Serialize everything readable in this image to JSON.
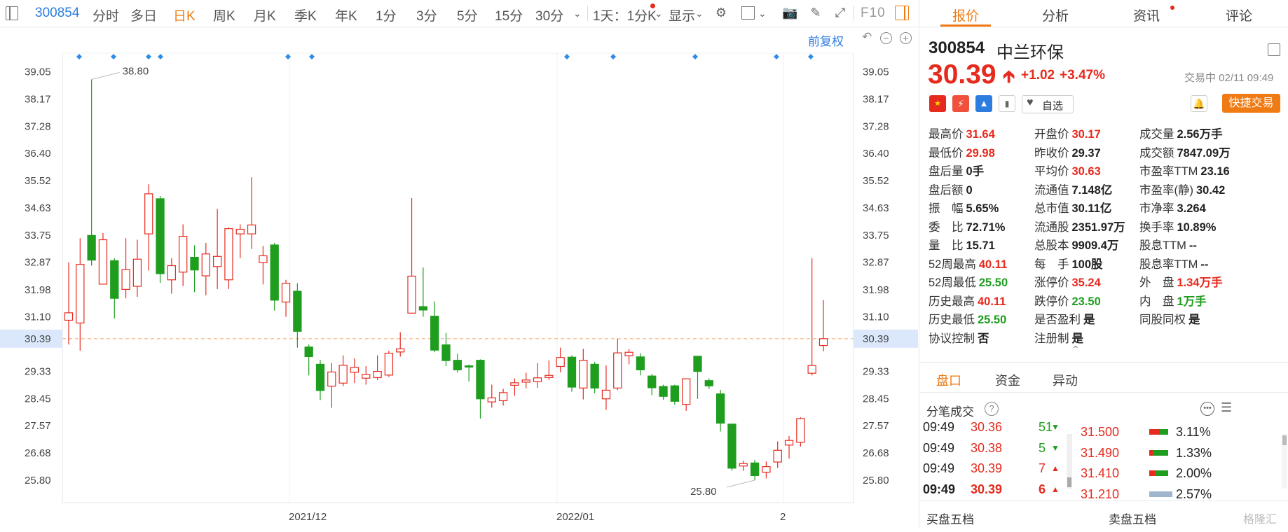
{
  "toolbar": {
    "code": "300854",
    "tabs": [
      "分时",
      "多日",
      "日K",
      "周K",
      "月K",
      "季K",
      "年K",
      "1分",
      "3分",
      "5分",
      "15分",
      "30分"
    ],
    "active_tab": "日K",
    "range_label": "1天：1分K",
    "display_label": "显示",
    "f10_label": "F10"
  },
  "chart": {
    "adjust_label": "前复权",
    "y_ticks": [
      "39.05",
      "38.17",
      "37.28",
      "36.40",
      "35.52",
      "34.63",
      "33.75",
      "32.87",
      "31.98",
      "31.10",
      "30.39",
      "29.33",
      "28.45",
      "27.57",
      "26.68",
      "25.80"
    ],
    "current_price_label": "30.39",
    "high_label": "38.80",
    "low_label": "25.80",
    "x_labels": [
      "2021/12",
      "2022/01",
      "2"
    ],
    "up_color": "#e62a1e",
    "down_color": "#1f9d1f",
    "candles": [
      {
        "o": 30.99,
        "c": 31.23,
        "h": 32.87,
        "l": 30.2
      },
      {
        "o": 30.9,
        "c": 32.8,
        "h": 33.65,
        "l": 30.0
      },
      {
        "o": 33.74,
        "c": 32.94,
        "h": 38.8,
        "l": 32.76
      },
      {
        "o": 32.16,
        "c": 33.6,
        "h": 33.82,
        "l": 32.15
      },
      {
        "o": 32.92,
        "c": 31.7,
        "h": 33.0,
        "l": 31.05
      },
      {
        "o": 31.99,
        "c": 32.63,
        "h": 33.65,
        "l": 31.7
      },
      {
        "o": 32.09,
        "c": 32.97,
        "h": 33.6,
        "l": 31.75
      },
      {
        "o": 33.79,
        "c": 35.09,
        "h": 35.4,
        "l": 32.6
      },
      {
        "o": 34.93,
        "c": 32.5,
        "h": 35.02,
        "l": 32.2
      },
      {
        "o": 32.3,
        "c": 32.76,
        "h": 33.0,
        "l": 31.85
      },
      {
        "o": 32.55,
        "c": 33.71,
        "h": 34.1,
        "l": 32.1
      },
      {
        "o": 33.03,
        "c": 32.62,
        "h": 33.42,
        "l": 31.9
      },
      {
        "o": 32.43,
        "c": 33.14,
        "h": 33.5,
        "l": 31.8
      },
      {
        "o": 32.73,
        "c": 33.06,
        "h": 34.6,
        "l": 32.0
      },
      {
        "o": 32.3,
        "c": 33.96,
        "h": 34.0,
        "l": 32.0
      },
      {
        "o": 33.79,
        "c": 33.94,
        "h": 34.1,
        "l": 33.0
      },
      {
        "o": 33.79,
        "c": 34.08,
        "h": 35.63,
        "l": 33.3
      },
      {
        "o": 32.86,
        "c": 33.08,
        "h": 33.4,
        "l": 32.15
      },
      {
        "o": 33.43,
        "c": 31.64,
        "h": 33.5,
        "l": 31.3
      },
      {
        "o": 31.58,
        "c": 32.19,
        "h": 32.3,
        "l": 31.1
      },
      {
        "o": 31.93,
        "c": 30.63,
        "h": 32.19,
        "l": 30.1
      },
      {
        "o": 30.12,
        "c": 29.81,
        "h": 30.2,
        "l": 29.2
      },
      {
        "o": 29.56,
        "c": 28.71,
        "h": 29.7,
        "l": 28.4
      },
      {
        "o": 28.85,
        "c": 29.31,
        "h": 29.6,
        "l": 28.15
      },
      {
        "o": 28.95,
        "c": 29.53,
        "h": 29.85,
        "l": 28.85
      },
      {
        "o": 29.3,
        "c": 29.46,
        "h": 29.75,
        "l": 28.95
      },
      {
        "o": 29.11,
        "c": 29.23,
        "h": 29.5,
        "l": 28.9
      },
      {
        "o": 29.13,
        "c": 29.33,
        "h": 29.85,
        "l": 29.05
      },
      {
        "o": 29.21,
        "c": 29.92,
        "h": 30.0,
        "l": 29.15
      },
      {
        "o": 29.96,
        "c": 30.06,
        "h": 30.6,
        "l": 29.81
      },
      {
        "o": 31.22,
        "c": 32.42,
        "h": 34.95,
        "l": 31.2
      },
      {
        "o": 31.43,
        "c": 31.32,
        "h": 32.7,
        "l": 31.1
      },
      {
        "o": 31.12,
        "c": 30.02,
        "h": 31.6,
        "l": 29.95
      },
      {
        "o": 30.19,
        "c": 29.68,
        "h": 30.58,
        "l": 29.5
      },
      {
        "o": 29.69,
        "c": 29.38,
        "h": 29.9,
        "l": 29.29
      },
      {
        "o": 29.51,
        "c": 29.47,
        "h": 29.55,
        "l": 29.0
      },
      {
        "o": 29.69,
        "c": 28.44,
        "h": 29.72,
        "l": 27.8
      },
      {
        "o": 28.34,
        "c": 28.47,
        "h": 28.9,
        "l": 28.15
      },
      {
        "o": 28.38,
        "c": 28.64,
        "h": 28.76,
        "l": 28.22
      },
      {
        "o": 28.88,
        "c": 28.96,
        "h": 29.1,
        "l": 28.54
      },
      {
        "o": 28.98,
        "c": 29.05,
        "h": 29.29,
        "l": 28.78
      },
      {
        "o": 29.0,
        "c": 29.12,
        "h": 29.6,
        "l": 28.8
      },
      {
        "o": 29.13,
        "c": 29.2,
        "h": 29.69,
        "l": 29.05
      },
      {
        "o": 29.49,
        "c": 29.78,
        "h": 30.1,
        "l": 29.3
      },
      {
        "o": 29.79,
        "c": 28.82,
        "h": 29.85,
        "l": 28.67
      },
      {
        "o": 28.79,
        "c": 29.69,
        "h": 30.06,
        "l": 28.42
      },
      {
        "o": 29.56,
        "c": 28.79,
        "h": 29.64,
        "l": 28.62
      },
      {
        "o": 28.44,
        "c": 28.72,
        "h": 29.52,
        "l": 28.08
      },
      {
        "o": 28.79,
        "c": 29.93,
        "h": 30.39,
        "l": 28.72
      },
      {
        "o": 29.84,
        "c": 29.95,
        "h": 30.05,
        "l": 29.56
      },
      {
        "o": 29.8,
        "c": 29.38,
        "h": 29.92,
        "l": 29.2
      },
      {
        "o": 29.18,
        "c": 28.8,
        "h": 29.25,
        "l": 28.55
      },
      {
        "o": 28.84,
        "c": 28.52,
        "h": 28.9,
        "l": 28.41
      },
      {
        "o": 28.86,
        "c": 28.36,
        "h": 28.9,
        "l": 28.25
      },
      {
        "o": 28.26,
        "c": 29.09,
        "h": 29.09,
        "l": 28.05
      },
      {
        "o": 29.82,
        "c": 29.33,
        "h": 29.83,
        "l": 28.44
      },
      {
        "o": 29.03,
        "c": 28.86,
        "h": 29.1,
        "l": 28.76
      },
      {
        "o": 28.6,
        "c": 27.65,
        "h": 28.73,
        "l": 27.38
      },
      {
        "o": 27.62,
        "c": 26.19,
        "h": 27.62,
        "l": 26.11
      },
      {
        "o": 26.26,
        "c": 26.34,
        "h": 26.43,
        "l": 26.1
      },
      {
        "o": 26.36,
        "c": 25.95,
        "h": 26.46,
        "l": 25.8
      },
      {
        "o": 26.06,
        "c": 26.24,
        "h": 26.41,
        "l": 25.86
      },
      {
        "o": 26.39,
        "c": 26.77,
        "h": 27.06,
        "l": 26.2
      },
      {
        "o": 26.94,
        "c": 27.09,
        "h": 27.23,
        "l": 26.5
      },
      {
        "o": 27.03,
        "c": 27.8,
        "h": 27.84,
        "l": 26.89
      },
      {
        "o": 29.27,
        "c": 29.52,
        "h": 33.0,
        "l": 29.2
      },
      {
        "o": 30.17,
        "c": 30.39,
        "h": 31.64,
        "l": 29.98
      }
    ]
  },
  "quote": {
    "code": "300854",
    "name": "中兰环保",
    "price": "30.39",
    "change": "+1.02",
    "change_pct": "+3.47%",
    "status": "交易中 02/11 09:49",
    "watch_label": "自选",
    "trade_label": "快捷交易"
  },
  "panel_tabs": [
    "报价",
    "分析",
    "资讯",
    "评论"
  ],
  "stats": [
    [
      {
        "k": "最高价",
        "v": "31.64",
        "c": "red"
      },
      {
        "k": "开盘价",
        "v": "30.17",
        "c": "red"
      },
      {
        "k": "成交量",
        "v": "2.56万手",
        "c": "dark"
      }
    ],
    [
      {
        "k": "最低价",
        "v": "29.98",
        "c": "red"
      },
      {
        "k": "昨收价",
        "v": "29.37",
        "c": "dark"
      },
      {
        "k": "成交额",
        "v": "7847.09万",
        "c": "dark"
      }
    ],
    [
      {
        "k": "盘后量",
        "v": "0手",
        "c": "dark"
      },
      {
        "k": "平均价",
        "v": "30.63",
        "c": "red"
      },
      {
        "k": "市盈率TTM",
        "v": "23.16",
        "c": "dark"
      }
    ],
    [
      {
        "k": "盘后额",
        "v": "0",
        "c": "dark"
      },
      {
        "k": "流通值",
        "v": "7.148亿",
        "c": "dark"
      },
      {
        "k": "市盈率(静)",
        "v": "30.42",
        "c": "dark"
      }
    ],
    [
      {
        "k": "振　幅",
        "v": "5.65%",
        "c": "dark"
      },
      {
        "k": "总市值",
        "v": "30.11亿",
        "c": "dark"
      },
      {
        "k": "市净率",
        "v": "3.264",
        "c": "dark"
      }
    ],
    [
      {
        "k": "委　比",
        "v": "72.71%",
        "c": "dark"
      },
      {
        "k": "流通股",
        "v": "2351.97万",
        "c": "dark"
      },
      {
        "k": "换手率",
        "v": "10.89%",
        "c": "dark"
      }
    ],
    [
      {
        "k": "量　比",
        "v": "15.71",
        "c": "dark"
      },
      {
        "k": "总股本",
        "v": "9909.4万",
        "c": "dark"
      },
      {
        "k": "股息TTM",
        "v": "--",
        "c": "dark"
      }
    ],
    [
      {
        "k": "52周最高",
        "v": "40.11",
        "c": "red"
      },
      {
        "k": "每　手",
        "v": "100股",
        "c": "dark"
      },
      {
        "k": "股息率TTM",
        "v": "--",
        "c": "dark"
      }
    ],
    [
      {
        "k": "52周最低",
        "v": "25.50",
        "c": "green"
      },
      {
        "k": "涨停价",
        "v": "35.24",
        "c": "red"
      },
      {
        "k": "外　盘",
        "v": "1.34万手",
        "c": "red"
      }
    ],
    [
      {
        "k": "历史最高",
        "v": "40.11",
        "c": "red"
      },
      {
        "k": "跌停价",
        "v": "23.50",
        "c": "green"
      },
      {
        "k": "内　盘",
        "v": "1万手",
        "c": "green"
      }
    ],
    [
      {
        "k": "历史最低",
        "v": "25.50",
        "c": "green"
      },
      {
        "k": "是否盈利",
        "v": "是",
        "c": "dark"
      },
      {
        "k": "同股同权",
        "v": "是",
        "c": "dark"
      }
    ],
    [
      {
        "k": "协议控制",
        "v": "否",
        "c": "dark"
      },
      {
        "k": "注册制",
        "v": "是",
        "c": "dark"
      },
      {
        "k": "",
        "v": "",
        "c": "dark"
      }
    ]
  ],
  "sub_tabs": [
    "盘口",
    "资金",
    "异动"
  ],
  "ticks_title": "分笔成交",
  "ticks": [
    {
      "time": "09:49",
      "price": "30.36",
      "vol": "51",
      "dir": "down"
    },
    {
      "time": "09:49",
      "price": "30.38",
      "vol": "5",
      "dir": "down"
    },
    {
      "time": "09:49",
      "price": "30.39",
      "vol": "7",
      "dir": "up"
    },
    {
      "time": "09:49",
      "price": "30.39",
      "vol": "6",
      "dir": "up"
    }
  ],
  "levels": [
    {
      "price": "31.500",
      "pct": "3.11%",
      "red": 0.55,
      "green": 0.45
    },
    {
      "price": "31.490",
      "pct": "1.33%",
      "red": 0.2,
      "green": 0.8
    },
    {
      "price": "31.410",
      "pct": "2.00%",
      "red": 0.3,
      "green": 0.7
    },
    {
      "price": "31.210",
      "pct": "2.57%",
      "red": 0,
      "green": 0
    }
  ],
  "bottom": {
    "buy_label": "买盘五档",
    "sell_label": "卖盘五档",
    "watermark": "格隆汇"
  }
}
